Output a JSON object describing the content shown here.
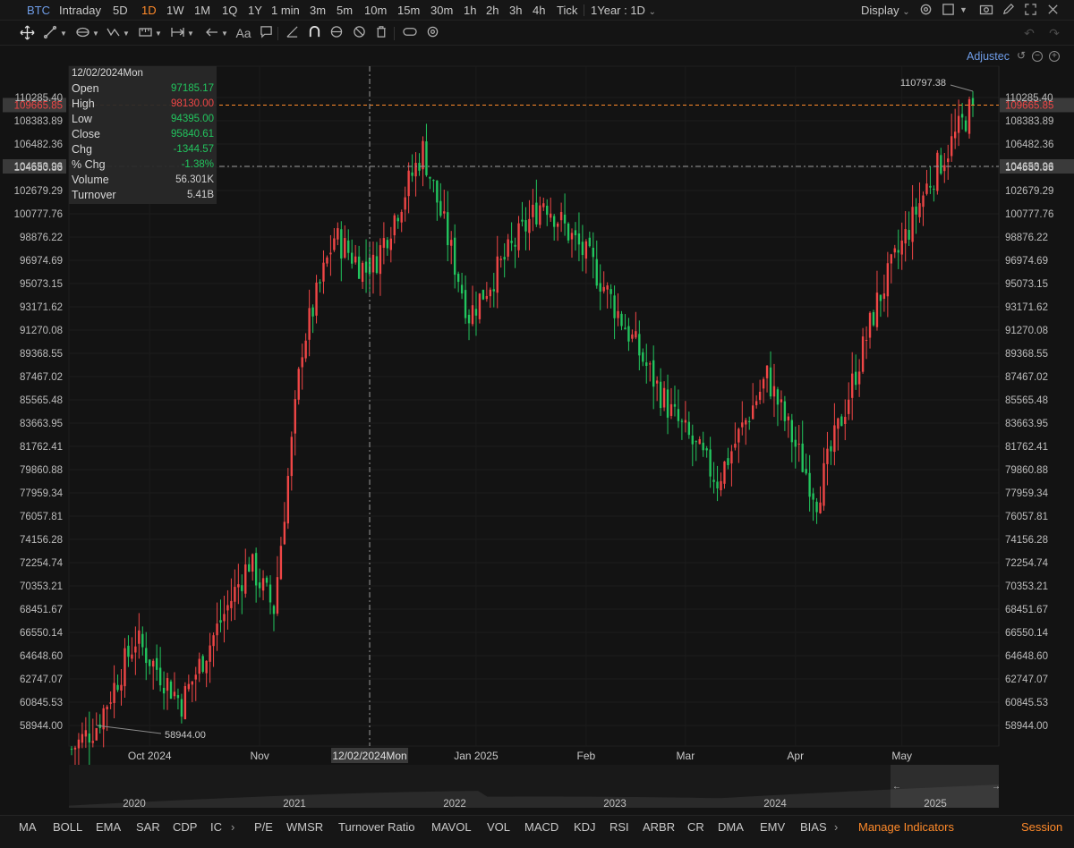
{
  "topbar": {
    "symbol": "BTC",
    "timeframes": [
      "Intraday",
      "5D",
      "1D",
      "1W",
      "1M",
      "1Q",
      "1Y",
      "1 min",
      "3m",
      "5m",
      "10m",
      "15m",
      "30m",
      "1h",
      "2h",
      "3h",
      "4h",
      "Tick"
    ],
    "active_timeframe": "1D",
    "range_label": "1Year : 1D",
    "display_label": "Display",
    "icons": [
      "settings-icon",
      "layout-icon",
      "camera-icon",
      "pencil-icon",
      "fullscreen-icon",
      "close-icon"
    ]
  },
  "drawing_toolbar": {
    "text_tool_label": "Aa",
    "icons": [
      "crosshair-move-icon",
      "trendline-icon",
      "fibonacci-icon",
      "pattern-icon",
      "measure-icon",
      "arrow-left-icon",
      "text-icon",
      "note-icon",
      "ruler-icon",
      "magnet-icon",
      "eye-icon",
      "hide-icon",
      "trash-icon",
      "toggle-icon",
      "settings-icon",
      "undo-icon",
      "redo-icon"
    ]
  },
  "chart_header": {
    "adjusted_label": "Adjustec"
  },
  "info_box": {
    "date": "12/02/2024Mon",
    "rows": [
      {
        "label": "Open",
        "value": "97185.17",
        "color": "#22c55e"
      },
      {
        "label": "High",
        "value": "98130.00",
        "color": "#f04646"
      },
      {
        "label": "Low",
        "value": "94395.00",
        "color": "#22c55e"
      },
      {
        "label": "Close",
        "value": "95840.61",
        "color": "#22c55e"
      },
      {
        "label": "Chg",
        "value": "-1344.57",
        "color": "#22c55e"
      },
      {
        "label": "% Chg",
        "value": "-1.38%",
        "color": "#22c55e"
      },
      {
        "label": "Volume",
        "value": "56.301K",
        "color": "#d0d0d0"
      },
      {
        "label": "Turnover",
        "value": "5.41B",
        "color": "#d0d0d0"
      }
    ]
  },
  "colors": {
    "up": "#f04646",
    "down": "#22c55e",
    "accent": "#ff8a2a",
    "background": "#131313"
  },
  "chart_data": {
    "type": "candlestick",
    "ylim": [
      58000,
      112000
    ],
    "y_ticks": [
      "110285.40",
      "108383.89",
      "106482.36",
      "104580.83",
      "102679.29",
      "100777.76",
      "98876.22",
      "96974.69",
      "95073.15",
      "93171.62",
      "91270.08",
      "89368.55",
      "87467.02",
      "85565.48",
      "83663.95",
      "81762.41",
      "79860.88",
      "77959.34",
      "76057.81",
      "74156.28",
      "72254.74",
      "70353.21",
      "68451.67",
      "66550.14",
      "64648.60",
      "62747.07",
      "60845.53",
      "58944.00"
    ],
    "x_labels": [
      "Oct 2024",
      "Nov",
      "Dec",
      "Jan 2025",
      "Feb",
      "Mar",
      "Apr",
      "May"
    ],
    "crosshair_x_label": "12/02/2024Mon",
    "last_price": "109665.85",
    "crosshair_price": "104653.96",
    "high_label": "110797.38",
    "low_label": "58944.00",
    "key_points": [
      {
        "date": "2024-09-09",
        "close": 57000
      },
      {
        "date": "2024-09-16",
        "close": 58944
      },
      {
        "date": "2024-09-27",
        "close": 66000
      },
      {
        "date": "2024-10-10",
        "close": 60800
      },
      {
        "date": "2024-10-29",
        "close": 72300
      },
      {
        "date": "2024-11-05",
        "close": 68500
      },
      {
        "date": "2024-11-13",
        "close": 90000
      },
      {
        "date": "2024-11-22",
        "close": 98900
      },
      {
        "date": "2024-12-02",
        "close": 95840
      },
      {
        "date": "2024-12-17",
        "close": 106000
      },
      {
        "date": "2024-12-30",
        "close": 92500
      },
      {
        "date": "2025-01-20",
        "close": 102000
      },
      {
        "date": "2025-02-03",
        "close": 96500
      },
      {
        "date": "2025-02-25",
        "close": 84500
      },
      {
        "date": "2025-03-10",
        "close": 79000
      },
      {
        "date": "2025-03-24",
        "close": 87500
      },
      {
        "date": "2025-04-07",
        "close": 77500
      },
      {
        "date": "2025-04-24",
        "close": 93500
      },
      {
        "date": "2025-05-08",
        "close": 103000
      },
      {
        "date": "2025-05-21",
        "close": 109665.85
      }
    ]
  },
  "navigator": {
    "years": [
      "2020",
      "2021",
      "2022",
      "2023",
      "2024",
      "2025"
    ]
  },
  "indicator_bar": {
    "items": [
      "MA",
      "BOLL",
      "EMA",
      "SAR",
      "CDP",
      "IC",
      "P/E",
      "WMSR",
      "Turnover Ratio",
      "MAVOL",
      "VOL",
      "MACD",
      "KDJ",
      "RSI",
      "ARBR",
      "CR",
      "DMA",
      "EMV",
      "BIAS"
    ],
    "manage_label": "Manage Indicators",
    "session_label": "Session"
  }
}
